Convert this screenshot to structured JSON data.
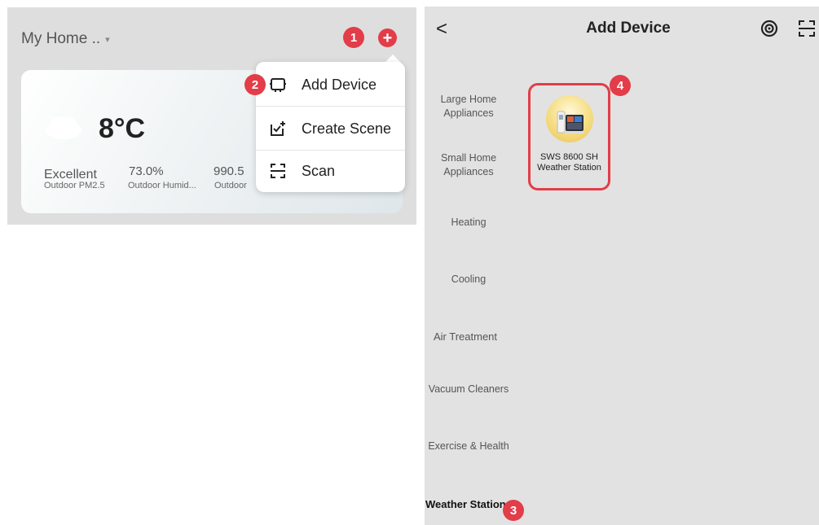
{
  "home_screen": {
    "home_name": "My Home ..",
    "caret": "▾",
    "plus_symbol": "+",
    "weather": {
      "temperature": "8°C",
      "pm_value": "Excellent",
      "pm_label": "Outdoor PM2.5",
      "humidity_value": "73.0%",
      "humidity_label": "Outdoor Humid...",
      "pressure_value": "990.5",
      "pressure_label": "Outdoor"
    },
    "menu": {
      "items": [
        {
          "label": "Add Device",
          "icon": "add-device-icon"
        },
        {
          "label": "Create Scene",
          "icon": "create-scene-icon"
        },
        {
          "label": "Scan",
          "icon": "scan-icon"
        }
      ]
    }
  },
  "add_device_screen": {
    "back": "<",
    "title": "Add Device",
    "categories": [
      "Large Home Appliances",
      "Small Home Appliances",
      "Heating",
      "Cooling",
      "Air Treatment",
      "Vacuum Cleaners",
      "Exercise & Health",
      "Weather Stations"
    ],
    "selected_category": "Weather Stations",
    "device": {
      "name": "SWS 8600 SH Weather Station"
    }
  },
  "step_badges": [
    "1",
    "2",
    "3",
    "4"
  ],
  "colors": {
    "accent": "#e23d48",
    "panel_bg": "#dedede",
    "card_bg": "#ffffff"
  }
}
